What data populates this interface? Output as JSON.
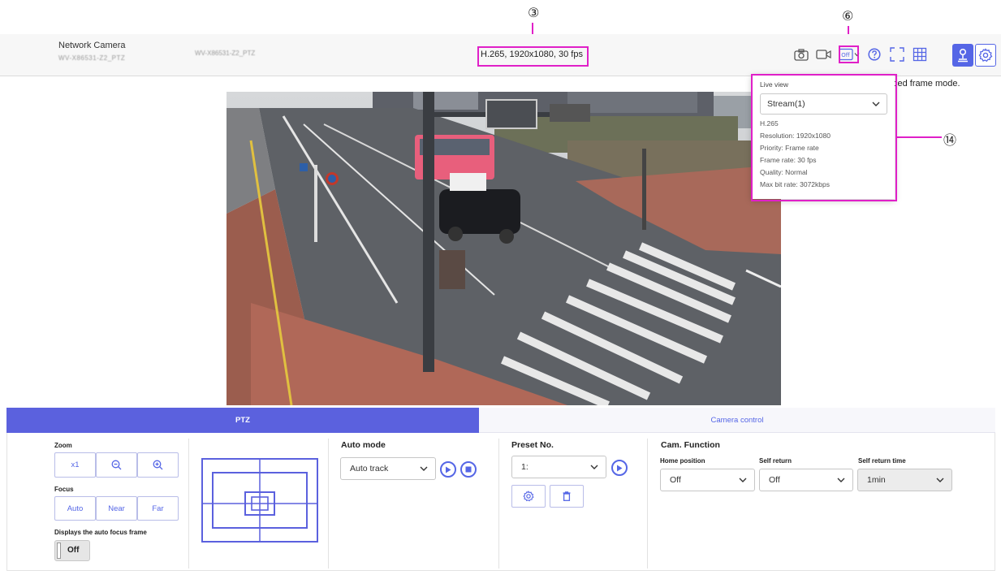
{
  "callouts": {
    "c3": "③",
    "c6": "⑥",
    "c14": "⑭"
  },
  "header": {
    "title": "Network Camera",
    "model_blurred": "WV-X86531-Z2_PTZ",
    "camera_name_blurred": "WV-X86531-Z2_PTZ",
    "stream_info": "H.265, 1920x1080, 30 fps",
    "icons": [
      "camera-snapshot-icon",
      "video-record-icon",
      "off-dropdown-icon",
      "help-icon",
      "fullscreen-icon",
      "grid-icon",
      "user-icon",
      "gear-icon"
    ],
    "off_badge": "Off"
  },
  "partial_text": "ced frame mode.",
  "live_view": {
    "title": "Live view",
    "stream_select": "Stream(1)",
    "codec": "H.265",
    "resolution": "Resolution: 1920x1080",
    "priority": "Priority: Frame rate",
    "frame_rate": "Frame rate: 30 fps",
    "quality": "Quality: Normal",
    "max_bit_rate": "Max bit rate: 3072kbps"
  },
  "tabs": {
    "ptz": "PTZ",
    "camera_control": "Camera control"
  },
  "zoom": {
    "label": "Zoom",
    "x1": "x1"
  },
  "focus": {
    "label": "Focus",
    "auto": "Auto",
    "near": "Near",
    "far": "Far"
  },
  "auto_focus_frame": {
    "label": "Displays the auto focus frame",
    "value": "Off"
  },
  "auto_mode": {
    "label": "Auto mode",
    "value": "Auto track"
  },
  "preset": {
    "label": "Preset No.",
    "value": "1:"
  },
  "cam_function": {
    "label": "Cam. Function",
    "home_position": {
      "label": "Home position",
      "value": "Off"
    },
    "self_return": {
      "label": "Self return",
      "value": "Off"
    },
    "self_return_time": {
      "label": "Self return time",
      "value": "1min"
    }
  },
  "colors": {
    "accent": "#5b61de",
    "callout": "#e020c8"
  }
}
